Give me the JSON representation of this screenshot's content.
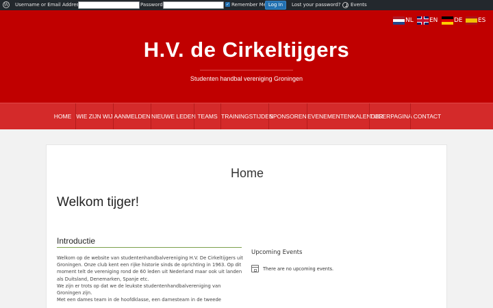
{
  "adminbar": {
    "username_label": "Username or Email Address",
    "username_value": "",
    "password_label": "Password",
    "password_value": "",
    "remember_label": "Remember Me",
    "login_button": "Log In",
    "lost_password": "Lost your password?",
    "events": "Events",
    "icons": [
      "wordpress-icon",
      "events-icon"
    ]
  },
  "languages": [
    {
      "code": "NL",
      "flag": "flag-nl"
    },
    {
      "code": "EN",
      "flag": "flag-en"
    },
    {
      "code": "DE",
      "flag": "flag-de"
    },
    {
      "code": "ES",
      "flag": "flag-es"
    }
  ],
  "header": {
    "title": "H.V. de Cirkeltijgers",
    "tagline": "Studenten handbal vereniging Groningen"
  },
  "nav": {
    "items": [
      "Home",
      "Wie zijn wij",
      "Aanmelden",
      "Nieuwe leden",
      "Teams",
      "Trainingstijden",
      "Sponsoren",
      "Evenementenkalender",
      "Tijgerpagina",
      "Contact"
    ]
  },
  "content": {
    "page_title": "Home",
    "welcome": "Welkom tijger!",
    "intro_heading": "Introductie",
    "intro_paragraphs": [
      "Welkom op de website van studentenhandbalvereniging H.V. De Cirkeltijgers uit Groningen. Onze club kent een rijke historie sinds de oprichting in 1963. Op dit moment telt de vereniging rond de 60 leden uit Nederland maar ook uit landen als Duitsland, Denemarken, Spanje etc.",
      "We zijn er trots op dat we de leukste studentenhandbalvereniging van Groningen zijn.",
      "Met een dames team in de hoofdklasse, een damesteam in de tweede"
    ],
    "events_heading": "Upcoming Events",
    "no_events": "There are no upcoming events."
  },
  "colors": {
    "header_red": "#c00000",
    "nav_red": "#d42a2a",
    "adminbar": "#23282d",
    "accent_green": "#7aa04a",
    "button_blue": "#2271b1"
  }
}
